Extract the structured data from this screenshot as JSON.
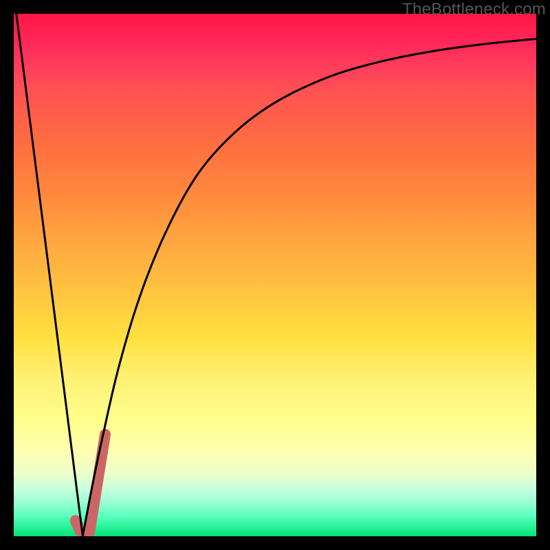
{
  "watermark": "TheBottleneck.com",
  "chart_data": {
    "type": "line",
    "title": "",
    "xlabel": "",
    "ylabel": "",
    "xlim": [
      0,
      1
    ],
    "ylim": [
      0,
      1
    ],
    "grid": false,
    "series": [
      {
        "name": "left-descending-line",
        "type": "line",
        "stroke": "#000000",
        "stroke_width": 3,
        "values": [
          {
            "x": 0.005,
            "y": 1.0
          },
          {
            "x": 0.132,
            "y": 0.0
          }
        ]
      },
      {
        "name": "curve",
        "type": "line",
        "stroke": "#000000",
        "stroke_width": 3,
        "values": [
          {
            "x": 0.132,
            "y": 0.0
          },
          {
            "x": 0.15,
            "y": 0.095
          },
          {
            "x": 0.17,
            "y": 0.19
          },
          {
            "x": 0.2,
            "y": 0.32
          },
          {
            "x": 0.24,
            "y": 0.455
          },
          {
            "x": 0.29,
            "y": 0.58
          },
          {
            "x": 0.35,
            "y": 0.69
          },
          {
            "x": 0.42,
            "y": 0.77
          },
          {
            "x": 0.5,
            "y": 0.83
          },
          {
            "x": 0.6,
            "y": 0.878
          },
          {
            "x": 0.7,
            "y": 0.908
          },
          {
            "x": 0.8,
            "y": 0.928
          },
          {
            "x": 0.9,
            "y": 0.942
          },
          {
            "x": 1.0,
            "y": 0.952
          }
        ]
      },
      {
        "name": "highlight-segment",
        "type": "line",
        "stroke": "#cc6666",
        "stroke_width": 16,
        "values": [
          {
            "x": 0.118,
            "y": 0.03
          },
          {
            "x": 0.128,
            "y": 0.008
          },
          {
            "x": 0.145,
            "y": 0.008
          },
          {
            "x": 0.175,
            "y": 0.195
          }
        ]
      }
    ],
    "background_gradient": {
      "top": "#ff1744",
      "bottom": "#00e676"
    }
  }
}
